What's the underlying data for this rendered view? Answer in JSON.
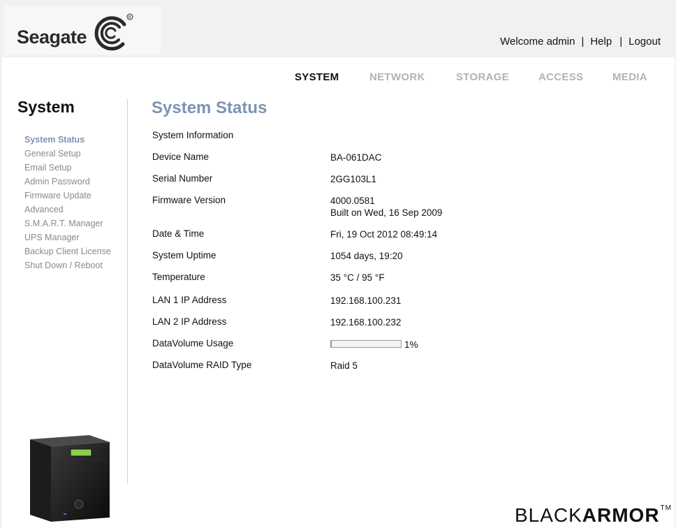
{
  "header": {
    "brand_logo_text": "Seagate",
    "welcome_text": "Welcome admin",
    "help_label": "Help",
    "logout_label": "Logout"
  },
  "nav": {
    "tabs": [
      {
        "label": "SYSTEM",
        "active": true
      },
      {
        "label": "NETWORK",
        "active": false
      },
      {
        "label": "STORAGE",
        "active": false
      },
      {
        "label": "ACCESS",
        "active": false
      },
      {
        "label": "MEDIA",
        "active": false
      }
    ]
  },
  "sidebar": {
    "title": "System",
    "items": [
      {
        "label": "System Status",
        "active": true
      },
      {
        "label": "General Setup"
      },
      {
        "label": "Email Setup"
      },
      {
        "label": "Admin Password"
      },
      {
        "label": "Firmware Update"
      },
      {
        "label": "Advanced"
      },
      {
        "label": "S.M.A.R.T. Manager"
      },
      {
        "label": "UPS Manager"
      },
      {
        "label": "Backup Client License"
      },
      {
        "label": "Shut Down / Reboot"
      }
    ]
  },
  "main": {
    "title": "System Status",
    "section_heading": "System Information",
    "rows": [
      {
        "label": "Device Name",
        "value": "BA-061DAC"
      },
      {
        "label": "Serial Number",
        "value": "2GG103L1"
      },
      {
        "label": "Firmware Version",
        "value": "4000.0581",
        "value2": "Built on Wed, 16 Sep 2009"
      },
      {
        "label": "Date & Time",
        "value": "Fri, 19 Oct 2012 08:49:14"
      },
      {
        "label": "System Uptime",
        "value": "1054 days, 19:20"
      },
      {
        "label": "Temperature",
        "value": "35 °C / 95 °F"
      },
      {
        "label": "LAN 1 IP Address",
        "value": "192.168.100.231"
      },
      {
        "label": "LAN 2 IP Address",
        "value": "192.168.100.232"
      },
      {
        "label": "DataVolume Usage",
        "value": "1%",
        "usage_fraction": 0.01
      },
      {
        "label": "DataVolume RAID Type",
        "value": "Raid 5"
      }
    ]
  },
  "footer": {
    "brand_light": "BLACK",
    "brand_bold": "ARMOR",
    "brand_tm": "TM"
  },
  "colors": {
    "accent": "#7d94b3",
    "inactive_nav": "#b3b3b3",
    "usage_fill": "#6b8fd1"
  }
}
